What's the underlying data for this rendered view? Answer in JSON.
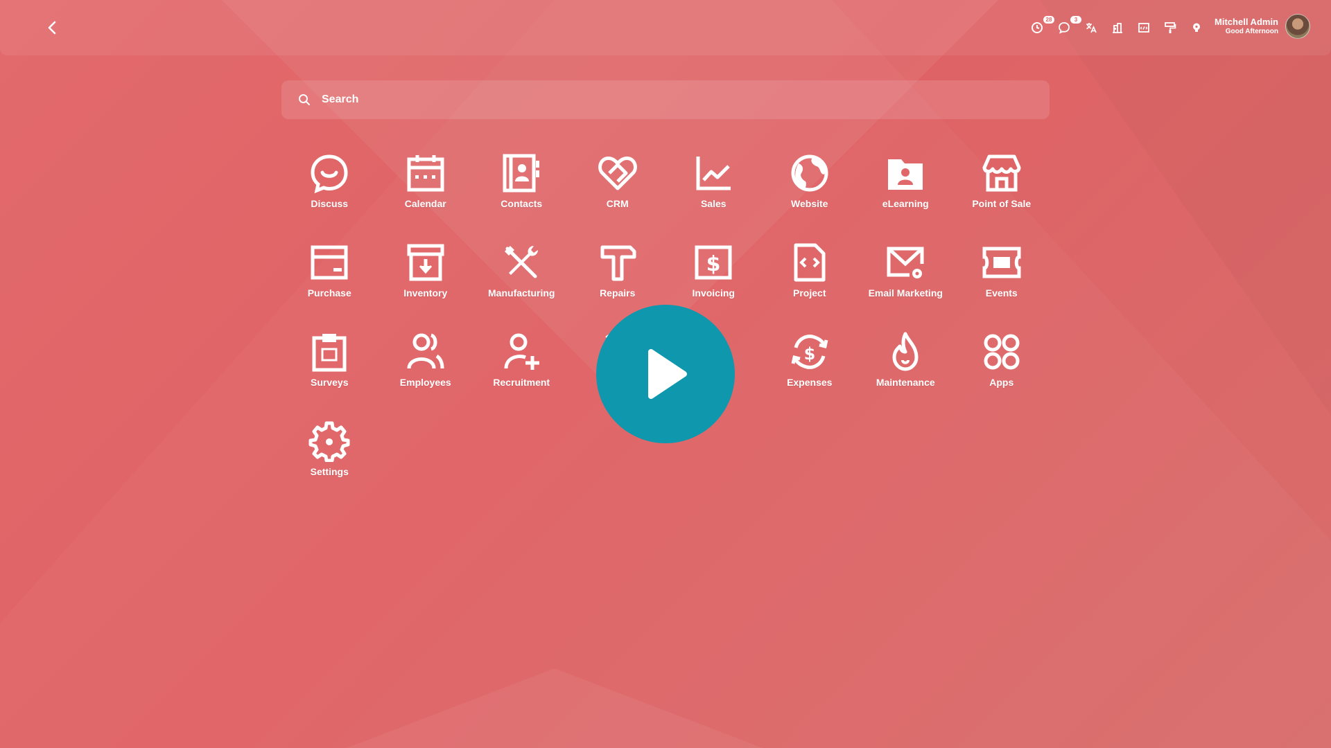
{
  "user": {
    "name": "Mitchell Admin",
    "greeting": "Good Afternoon"
  },
  "systray": {
    "activity_count": "28",
    "messages_count": "3"
  },
  "search": {
    "placeholder": "Search"
  },
  "apps": [
    {
      "label": "Discuss",
      "icon": "discuss-icon"
    },
    {
      "label": "Calendar",
      "icon": "calendar-icon"
    },
    {
      "label": "Contacts",
      "icon": "contacts-icon"
    },
    {
      "label": "CRM",
      "icon": "crm-icon"
    },
    {
      "label": "Sales",
      "icon": "sales-icon"
    },
    {
      "label": "Website",
      "icon": "website-icon"
    },
    {
      "label": "eLearning",
      "icon": "elearning-icon"
    },
    {
      "label": "Point of Sale",
      "icon": "point-of-sale-icon"
    },
    {
      "label": "Purchase",
      "icon": "purchase-icon"
    },
    {
      "label": "Inventory",
      "icon": "inventory-icon"
    },
    {
      "label": "Manufacturing",
      "icon": "manufacturing-icon"
    },
    {
      "label": "Repairs",
      "icon": "repairs-icon"
    },
    {
      "label": "Invoicing",
      "icon": "invoicing-icon"
    },
    {
      "label": "Project",
      "icon": "project-icon"
    },
    {
      "label": "Email Marketing",
      "icon": "email-marketing-icon"
    },
    {
      "label": "Events",
      "icon": "events-icon"
    },
    {
      "label": "Surveys",
      "icon": "surveys-icon"
    },
    {
      "label": "Employees",
      "icon": "employees-icon"
    },
    {
      "label": "Recruitment",
      "icon": "recruitment-icon"
    },
    {
      "label": "At",
      "icon": "attendances-icon"
    },
    {
      "label": "",
      "icon": "hidden-app-icon"
    },
    {
      "label": "Expenses",
      "icon": "expenses-icon"
    },
    {
      "label": "Maintenance",
      "icon": "maintenance-icon"
    },
    {
      "label": "Apps",
      "icon": "apps-icon"
    },
    {
      "label": "Settings",
      "icon": "settings-icon"
    }
  ],
  "colors": {
    "background": "#e0686a",
    "play_button": "#0f97ad",
    "foreground": "#ffffff"
  }
}
